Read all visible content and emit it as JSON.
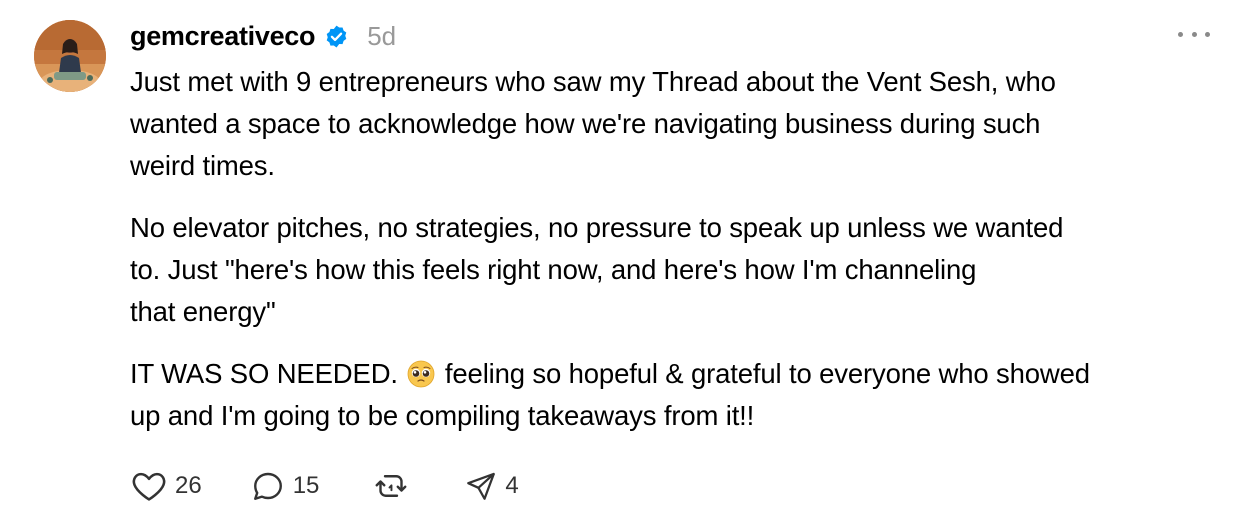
{
  "post": {
    "username": "gemcreativeco",
    "timestamp": "5d",
    "verified": true,
    "paragraphs": [
      {
        "lines": [
          "Just met with 9 entrepreneurs who saw my Thread about the Vent Sesh, who",
          "wanted a space to acknowledge how we're navigating business during such",
          "weird times."
        ]
      },
      {
        "lines": [
          "No elevator pitches, no strategies, no pressure to speak up unless we wanted",
          "to. Just \"here's how this feels right now, and here's how I'm channeling",
          "that energy\""
        ]
      },
      {
        "line1_before_emoji": "IT WAS SO NEEDED.",
        "emoji": "pleading-face",
        "line1_after_emoji": "feeling so hopeful & grateful to everyone who showed",
        "line2": "up and I'm going to be compiling takeaways from it!!"
      }
    ]
  },
  "actions": {
    "like": {
      "icon": "heart-icon",
      "count": "26"
    },
    "reply": {
      "icon": "comment-icon",
      "count": "15"
    },
    "repost": {
      "icon": "repost-icon",
      "count": ""
    },
    "share": {
      "icon": "send-icon",
      "count": "4"
    }
  },
  "colors": {
    "text": "#000000",
    "muted": "#999999",
    "verified_blue": "#0095f6",
    "icon": "#333333"
  }
}
